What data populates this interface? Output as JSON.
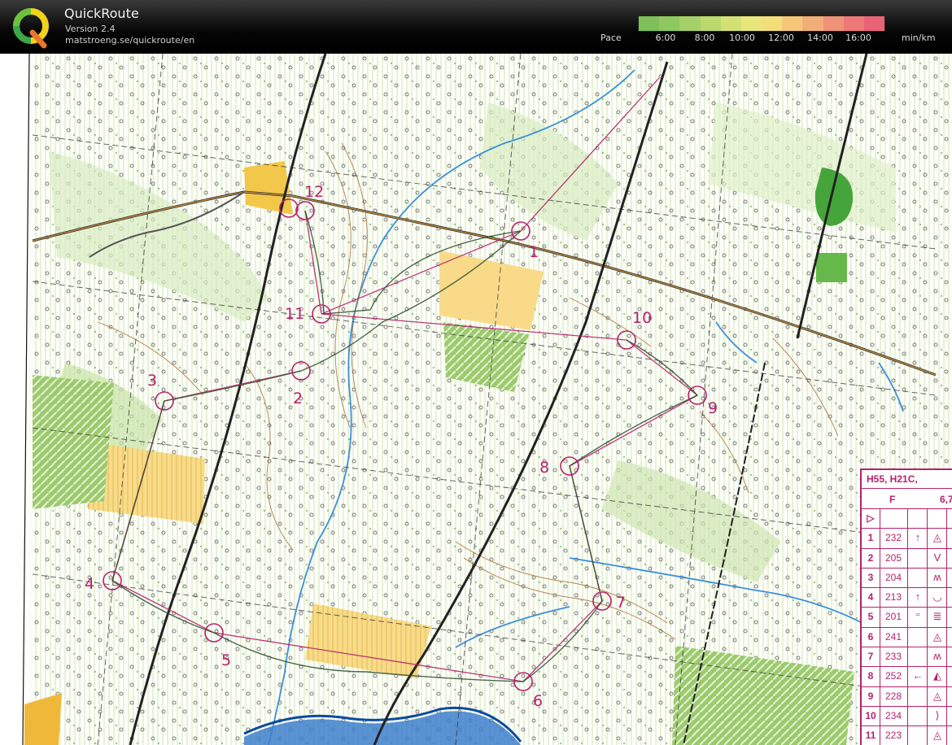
{
  "header": {
    "app_name": "QuickRoute",
    "version": "Version 2.4",
    "url": "matstroeng.se/quickroute/en",
    "logo_icon": "quickroute-q-logo"
  },
  "pace_scale": {
    "label": "Pace",
    "unit": "min/km",
    "ticks": [
      "6:00",
      "8:00",
      "10:00",
      "12:00",
      "14:00",
      "16:00"
    ],
    "colors": [
      "#7fbf5a",
      "#8ec85f",
      "#a5d168",
      "#bcd96e",
      "#d3e074",
      "#e8e67b",
      "#f3de7a",
      "#f4c878",
      "#f2ae77",
      "#ef9278",
      "#ec7878",
      "#e96377"
    ]
  },
  "map": {
    "course_color": "#b5226a",
    "controls": [
      {
        "num": "1",
        "label": "1"
      },
      {
        "num": "2",
        "label": "2"
      },
      {
        "num": "3",
        "label": "3"
      },
      {
        "num": "4",
        "label": "4"
      },
      {
        "num": "5",
        "label": "5"
      },
      {
        "num": "6",
        "label": "6"
      },
      {
        "num": "7",
        "label": "7"
      },
      {
        "num": "8",
        "label": "8"
      },
      {
        "num": "9",
        "label": "9"
      },
      {
        "num": "10",
        "label": "10"
      },
      {
        "num": "11",
        "label": "11"
      },
      {
        "num": "12",
        "label": "12"
      }
    ]
  },
  "description_sheet": {
    "class_header": "H55, H21C,",
    "course_code": "F",
    "length": "6,7",
    "start_symbol": "▷",
    "rows": [
      {
        "n": "1",
        "code": "232",
        "sym": "↑",
        "feat": "◬"
      },
      {
        "n": "2",
        "code": "205",
        "sym": "",
        "feat": "V"
      },
      {
        "n": "3",
        "code": "204",
        "sym": "",
        "feat": "ʍ"
      },
      {
        "n": "4",
        "code": "213",
        "sym": "↑",
        "feat": "◡"
      },
      {
        "n": "5",
        "code": "201",
        "sym": "⁼",
        "feat": "≣"
      },
      {
        "n": "6",
        "code": "241",
        "sym": "",
        "feat": "◬"
      },
      {
        "n": "7",
        "code": "233",
        "sym": "",
        "feat": "ʍ"
      },
      {
        "n": "8",
        "code": "252",
        "sym": "←",
        "feat": "◭"
      },
      {
        "n": "9",
        "code": "228",
        "sym": "",
        "feat": "◬"
      },
      {
        "n": "10",
        "code": "234",
        "sym": "",
        "feat": "⟩"
      },
      {
        "n": "11",
        "code": "223",
        "sym": "",
        "feat": "◬"
      }
    ]
  }
}
